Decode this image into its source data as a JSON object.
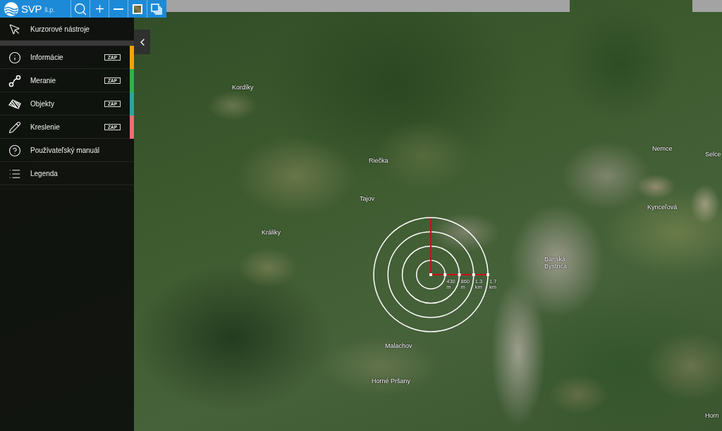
{
  "toolbar": {
    "brand": "SVP",
    "brand_suffix": "š.p."
  },
  "sidebar": {
    "tools": {
      "label": "Kurzorové nástroje"
    },
    "items": [
      {
        "label": "Informácie",
        "badge": "ZAP",
        "color": "#f5a300"
      },
      {
        "label": "Meranie",
        "badge": "ZAP",
        "color": "#2bb34a"
      },
      {
        "label": "Objekty",
        "badge": "ZAP",
        "color": "#27a99b"
      },
      {
        "label": "Kreslenie",
        "badge": "ZAP",
        "color": "#ec6f72"
      },
      {
        "label": "Používateľský manuál"
      },
      {
        "label": "Legenda"
      }
    ]
  },
  "map": {
    "labels": [
      "Kordíky",
      "Riečka",
      "Tajov",
      "Králiky",
      "Nemce",
      "Selce",
      "Kynceľová",
      "Banská Bystrica",
      "Malachov",
      "Horné Pršany",
      "Horn"
    ],
    "measurement": {
      "distances": [
        "430 m",
        "860 m",
        "1.3 km",
        "1.7 km"
      ]
    }
  }
}
